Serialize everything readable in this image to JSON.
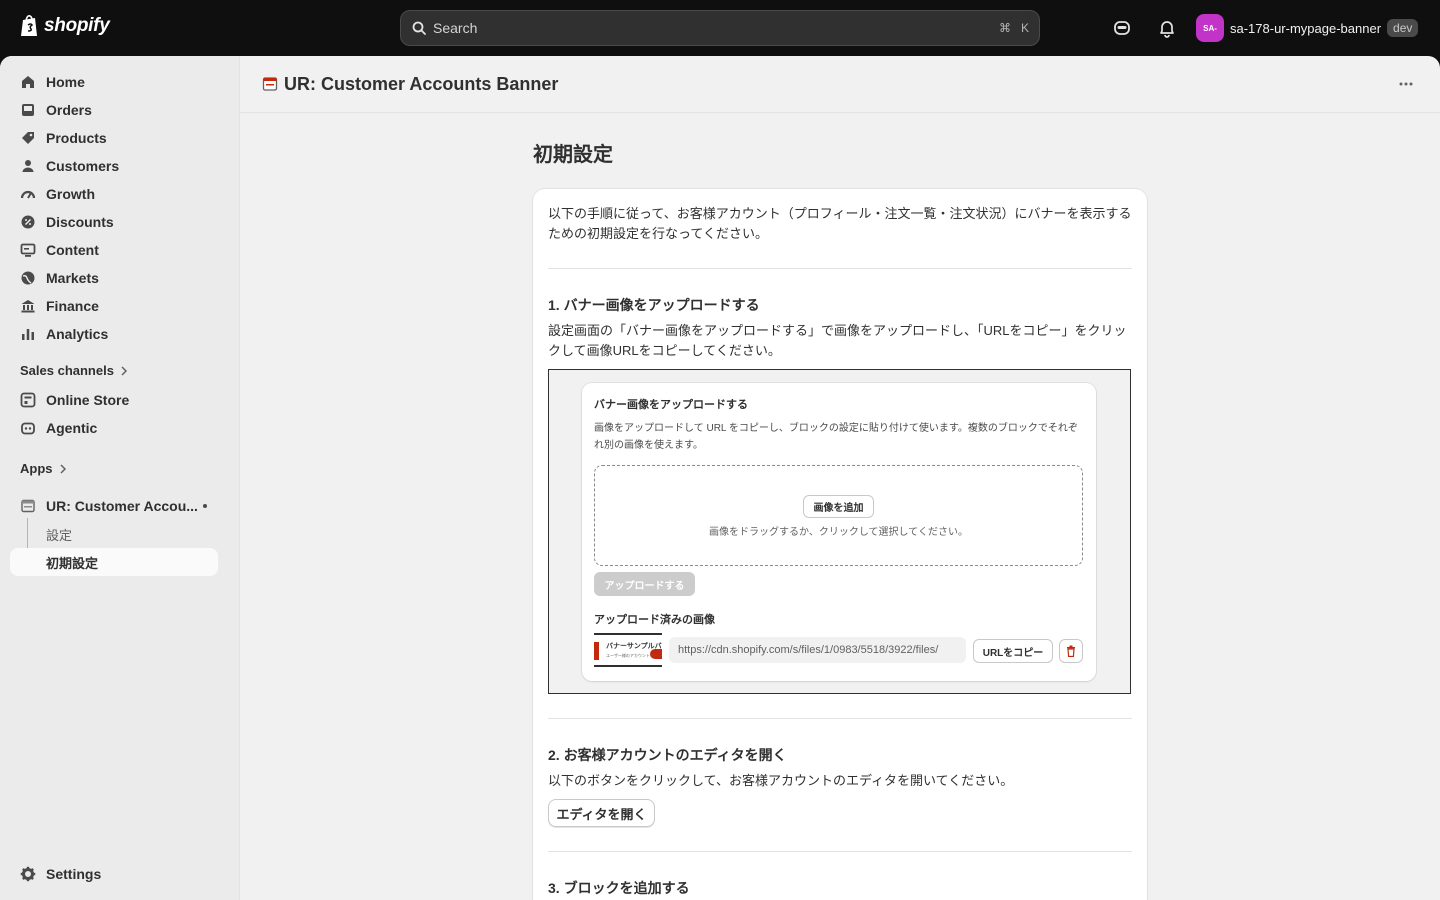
{
  "topbar": {
    "logo_text": "shopify",
    "search_placeholder": "Search",
    "shortcut_cmd": "⌘",
    "shortcut_key": "K",
    "store_avatar": "SA-",
    "store_name": "sa-178-ur-mypage-banner",
    "store_badge": "dev"
  },
  "sidebar": {
    "items": [
      {
        "label": "Home",
        "icon": "home-icon"
      },
      {
        "label": "Orders",
        "icon": "inbox-icon"
      },
      {
        "label": "Products",
        "icon": "tag-icon"
      },
      {
        "label": "Customers",
        "icon": "person-icon"
      },
      {
        "label": "Growth",
        "icon": "gauge-icon"
      },
      {
        "label": "Discounts",
        "icon": "discount-icon"
      },
      {
        "label": "Content",
        "icon": "monitor-icon"
      },
      {
        "label": "Markets",
        "icon": "globe-icon"
      },
      {
        "label": "Finance",
        "icon": "bank-icon"
      },
      {
        "label": "Analytics",
        "icon": "bar-chart-icon"
      }
    ],
    "sales_channels_label": "Sales channels",
    "channels": [
      {
        "label": "Online Store",
        "icon": "store-icon"
      },
      {
        "label": "Agentic",
        "icon": "robot-icon"
      }
    ],
    "apps_label": "Apps",
    "app": {
      "label": "UR: Customer Accou...",
      "sub_items": [
        "設定",
        "初期設定"
      ]
    },
    "settings_label": "Settings"
  },
  "header": {
    "title": "UR: Customer Accounts Banner"
  },
  "main": {
    "heading": "初期設定",
    "intro": "以下の手順に従って、お客様アカウント（プロフィール・注文一覧・注文状況）にバナーを表示するための初期設定を行なってください。",
    "step1": {
      "title": "1. バナー画像をアップロードする",
      "text": "設定画面の「バナー画像をアップロードする」で画像をアップロードし、「URLをコピー」をクリックして画像URLをコピーしてください。"
    },
    "screenshot": {
      "title": "バナー画像をアップロードする",
      "text": "画像をアップロードして URL をコピーし、ブロックの設定に貼り付けて使います。複数のブロックでそれぞれ別の画像を使えます。",
      "add_image": "画像を追加",
      "drop_hint": "画像をドラッグするか、クリックして選択してください。",
      "upload_button": "アップロードする",
      "uploaded_title": "アップロード済みの画像",
      "thumb_text": "バナーサンプルバナー",
      "thumb_sub": "ユーザー様のアカウントページ",
      "url": "https://cdn.shopify.com/s/files/1/0983/5518/3922/files/",
      "copy_button": "URLをコピー"
    },
    "step2": {
      "title": "2. お客様アカウントのエディタを開く",
      "text": "以下のボタンをクリックして、お客様アカウントのエディタを開いてください。",
      "button": "エディタを開く"
    },
    "step3": {
      "title": "3. ブロックを追加する"
    }
  },
  "colors": {
    "topbar_bg": "#0f0f0f",
    "avatar": "#c234c8",
    "danger": "#c5280c"
  }
}
